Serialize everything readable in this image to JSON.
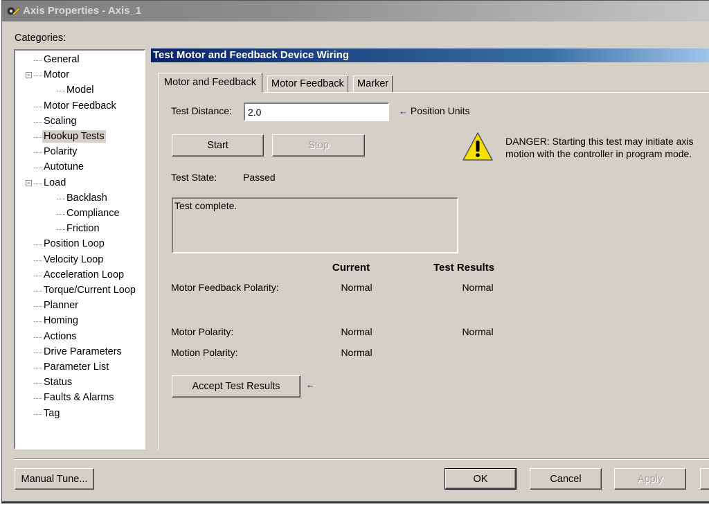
{
  "window": {
    "title": "Axis Properties - Axis_1"
  },
  "categories_label": "Categories:",
  "tree": [
    {
      "label": "General",
      "level": 0
    },
    {
      "label": "Motor",
      "level": 0,
      "expanded": true
    },
    {
      "label": "Model",
      "level": 1
    },
    {
      "label": "Motor Feedback",
      "level": 0
    },
    {
      "label": "Scaling",
      "level": 0
    },
    {
      "label": "Hookup Tests",
      "level": 0,
      "selected": true
    },
    {
      "label": "Polarity",
      "level": 0
    },
    {
      "label": "Autotune",
      "level": 0
    },
    {
      "label": "Load",
      "level": 0,
      "expanded": true
    },
    {
      "label": "Backlash",
      "level": 1
    },
    {
      "label": "Compliance",
      "level": 1
    },
    {
      "label": "Friction",
      "level": 1
    },
    {
      "label": "Position Loop",
      "level": 0
    },
    {
      "label": "Velocity Loop",
      "level": 0
    },
    {
      "label": "Acceleration Loop",
      "level": 0
    },
    {
      "label": "Torque/Current Loop",
      "level": 0
    },
    {
      "label": "Planner",
      "level": 0
    },
    {
      "label": "Homing",
      "level": 0
    },
    {
      "label": "Actions",
      "level": 0
    },
    {
      "label": "Drive Parameters",
      "level": 0
    },
    {
      "label": "Parameter List",
      "level": 0
    },
    {
      "label": "Status",
      "level": 0
    },
    {
      "label": "Faults & Alarms",
      "level": 0
    },
    {
      "label": "Tag",
      "level": 0
    }
  ],
  "section_title": "Test Motor and Feedback Device Wiring",
  "tabs": [
    "Motor and Feedback",
    "Motor Feedback",
    "Marker"
  ],
  "form": {
    "test_distance_label": "Test Distance:",
    "test_distance_value": "2.0",
    "units_label": "Position Units",
    "start": "Start",
    "stop": "Stop",
    "danger_line1": "DANGER: Starting this test may initiate axis",
    "danger_line2": "motion with the controller in program mode.",
    "test_state_label": "Test State:",
    "test_state_value": "Passed",
    "message": "Test complete.",
    "col_current": "Current",
    "col_results": "Test Results",
    "rows": [
      {
        "label": "Motor Feedback Polarity:",
        "current": "Normal",
        "result": "Normal"
      },
      {
        "label": "Motor Polarity:",
        "current": "Normal",
        "result": "Normal"
      },
      {
        "label": "Motion Polarity:",
        "current": "Normal",
        "result": ""
      }
    ],
    "accept": "Accept Test Results"
  },
  "footer": {
    "manual_tune": "Manual Tune...",
    "ok": "OK",
    "cancel": "Cancel",
    "apply": "Apply"
  },
  "colors": {
    "header": "#0a246a",
    "face": "#d4d0c8",
    "arrow": "#0a246a"
  }
}
